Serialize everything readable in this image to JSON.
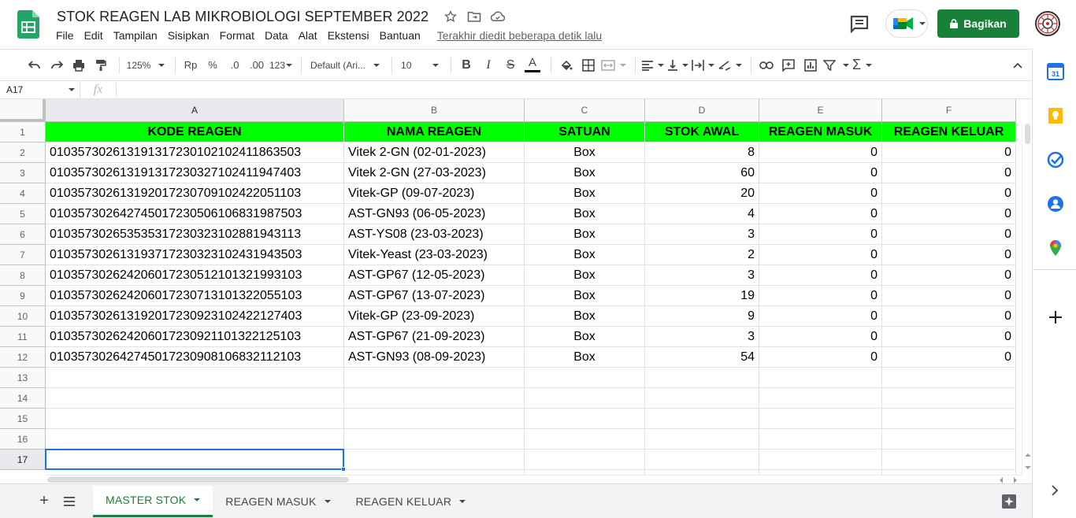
{
  "header": {
    "doc_title": "STOK REAGEN LAB MIKROBIOLOGI SEPTEMBER 2022",
    "menu": [
      "File",
      "Edit",
      "Tampilan",
      "Sisipkan",
      "Format",
      "Data",
      "Alat",
      "Ekstensi",
      "Bantuan"
    ],
    "last_edit": "Terakhir diedit beberapa detik lalu",
    "share_label": "Bagikan"
  },
  "toolbar": {
    "zoom": "125%",
    "currency": "Rp",
    "percent": "%",
    "dec_decrease": ".0",
    "dec_increase": ".00",
    "number_format": "123",
    "font": "Default (Ari...",
    "font_size": "10"
  },
  "formula_bar": {
    "name_box": "A17",
    "fx": "fx",
    "value": ""
  },
  "columns": [
    "A",
    "B",
    "C",
    "D",
    "E",
    "F"
  ],
  "row_numbers": [
    "1",
    "2",
    "3",
    "4",
    "5",
    "6",
    "7",
    "8",
    "9",
    "10",
    "11",
    "12",
    "13",
    "14",
    "15",
    "16",
    "17"
  ],
  "table": {
    "headers": [
      "KODE REAGEN",
      "NAMA REAGEN",
      "SATUAN",
      "STOK AWAL",
      "REAGEN MASUK",
      "REAGEN KELUAR"
    ],
    "rows": [
      [
        "01035730261319131723010210241186350 3",
        "Vitek 2-GN (02-01-2023)",
        "Box",
        "8",
        "0",
        "0"
      ],
      [
        "010357302613191317230327102411947403",
        "Vitek 2-GN (27-03-2023)",
        "Box",
        "60",
        "0",
        "0"
      ],
      [
        "010357302613192017230709102422051103",
        "Vitek-GP (09-07-2023)",
        "Box",
        "20",
        "0",
        "0"
      ],
      [
        "010357302642745017230506106831987503",
        "AST-GN93 (06-05-2023)",
        "Box",
        "4",
        "0",
        "0"
      ],
      [
        "010357302653535317230323102881943113",
        "AST-YS08 (23-03-2023)",
        "Box",
        "3",
        "0",
        "0"
      ],
      [
        "010357302613193717230323102431943503",
        "Vitek-Yeast (23-03-2023)",
        "Box",
        "2",
        "0",
        "0"
      ],
      [
        "010357302624206017230512101321993103",
        "AST-GP67 (12-05-2023)",
        "Box",
        "3",
        "0",
        "0"
      ],
      [
        "010357302624206017230713101322055103",
        "AST-GP67 (13-07-2023)",
        "Box",
        "19",
        "0",
        "0"
      ],
      [
        "010357302613192017230923102422127403",
        "Vitek-GP (23-09-2023)",
        "Box",
        "9",
        "0",
        "0"
      ],
      [
        "010357302624206017230921101322125103",
        "AST-GP67 (21-09-2023)",
        "Box",
        "3",
        "0",
        "0"
      ],
      [
        "010357302642745017230908106832112103",
        "AST-GN93 (08-09-2023)",
        "Box",
        "54",
        "0",
        "0"
      ]
    ]
  },
  "sheets": [
    {
      "label": "MASTER STOK",
      "active": true
    },
    {
      "label": "REAGEN MASUK",
      "active": false
    },
    {
      "label": "REAGEN KELUAR",
      "active": false
    }
  ],
  "colors": {
    "header_fill": "#00ff00",
    "share_green": "#188038",
    "selection_blue": "#1a73e8"
  }
}
